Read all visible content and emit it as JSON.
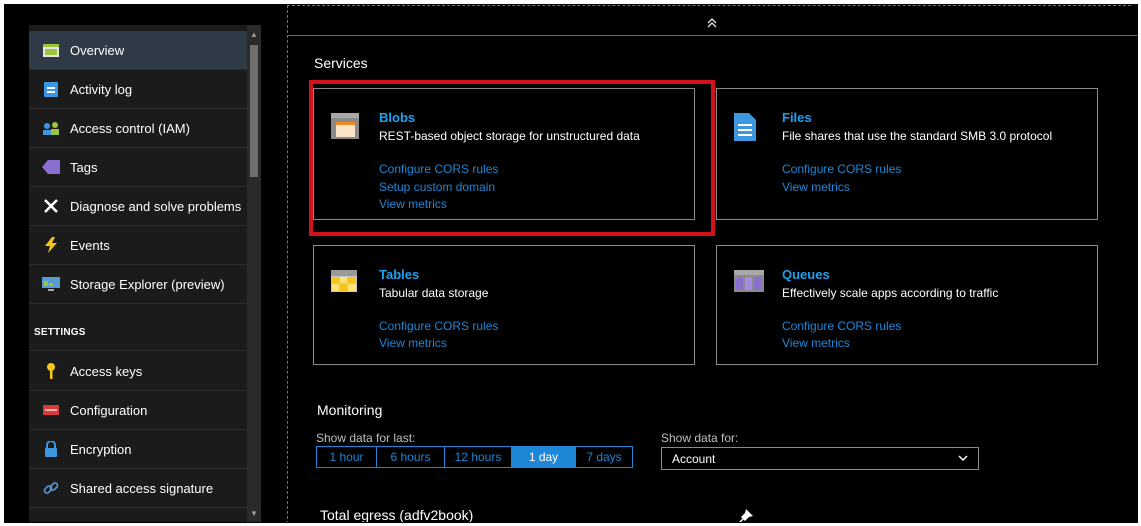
{
  "sidebar": {
    "items": [
      {
        "label": "Overview",
        "icon": "overview-icon",
        "active": true
      },
      {
        "label": "Activity log",
        "icon": "activity-log-icon"
      },
      {
        "label": "Access control (IAM)",
        "icon": "people-icon"
      },
      {
        "label": "Tags",
        "icon": "tag-icon"
      },
      {
        "label": "Diagnose and solve problems",
        "icon": "wrench-icon"
      },
      {
        "label": "Events",
        "icon": "lightning-icon"
      },
      {
        "label": "Storage Explorer (preview)",
        "icon": "storage-explorer-icon"
      }
    ],
    "settings_header": "SETTINGS",
    "settings_items": [
      {
        "label": "Access keys",
        "icon": "key-icon"
      },
      {
        "label": "Configuration",
        "icon": "configuration-icon"
      },
      {
        "label": "Encryption",
        "icon": "lock-icon"
      },
      {
        "label": "Shared access signature",
        "icon": "link-icon"
      }
    ]
  },
  "main": {
    "services_title": "Services",
    "cards": [
      {
        "title": "Blobs",
        "desc": "REST-based object storage for unstructured data",
        "links": [
          "Configure CORS rules",
          "Setup custom domain",
          "View metrics"
        ],
        "icon": "blob-icon"
      },
      {
        "title": "Files",
        "desc": "File shares that use the standard SMB 3.0 protocol",
        "links": [
          "Configure CORS rules",
          "View metrics"
        ],
        "icon": "file-icon"
      },
      {
        "title": "Tables",
        "desc": "Tabular data storage",
        "links": [
          "Configure CORS rules",
          "View metrics"
        ],
        "icon": "table-icon"
      },
      {
        "title": "Queues",
        "desc": "Effectively scale apps according to traffic",
        "links": [
          "Configure CORS rules",
          "View metrics"
        ],
        "icon": "queue-icon"
      }
    ],
    "monitoring_title": "Monitoring",
    "show_data_last_label": "Show data for last:",
    "time_options": [
      "1 hour",
      "6 hours",
      "12 hours",
      "1 day",
      "7 days"
    ],
    "selected_time": "1 day",
    "show_data_for_label": "Show data for:",
    "show_data_for_value": "Account",
    "egress_title": "Total egress (adfv2book)"
  },
  "colors": {
    "accent": "#1e86d6",
    "highlight": "#d4121c",
    "title_blue": "#1aa1f0"
  }
}
